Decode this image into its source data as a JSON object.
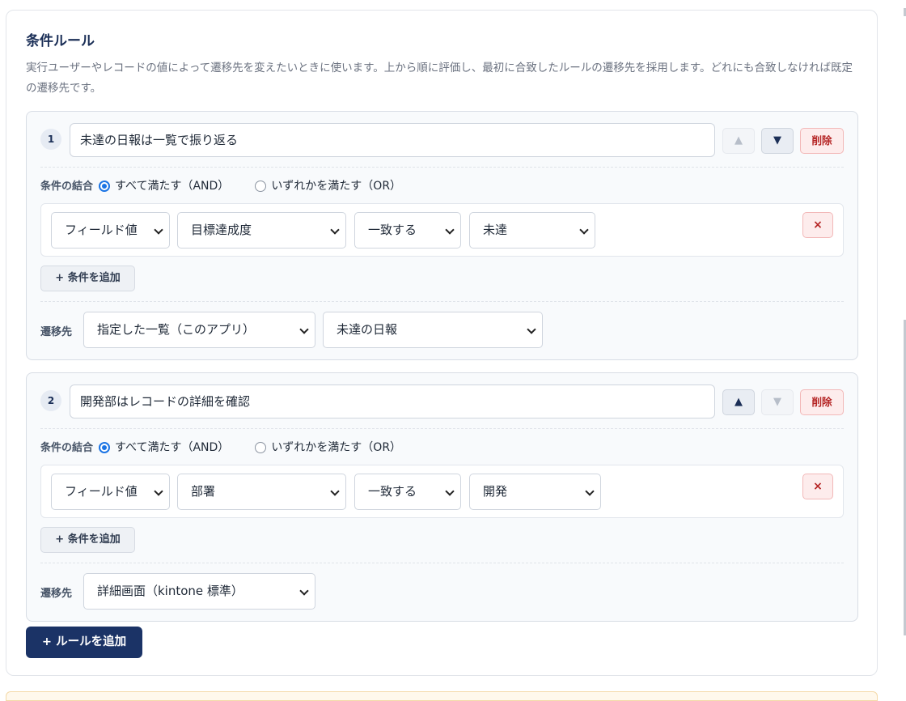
{
  "section": {
    "title": "条件ルール",
    "description": "実行ユーザーやレコードの値によって遷移先を変えたいときに使います。上から順に評価し、最初に合致したルールの遷移先を採用します。どれにも合致しなければ既定の遷移先です。"
  },
  "labels": {
    "combine": "条件の結合",
    "and": "すべて満たす（AND）",
    "or": "いずれかを満たす（OR）",
    "add_condition": "+ 条件を追加",
    "destination": "遷移先",
    "delete": "削除",
    "remove": "×",
    "up": "▲",
    "down": "▼",
    "add_rule": "+ ルールを追加"
  },
  "rules": [
    {
      "number": "1",
      "name": "未達の日報は一覧で振り返る",
      "combine": "and",
      "up_enabled": false,
      "down_enabled": true,
      "condition": {
        "type": "フィールド値",
        "field": "目標達成度",
        "operator": "一致する",
        "value": "未達"
      },
      "destination": {
        "type": "指定した一覧（このアプリ）",
        "view": "未達の日報"
      }
    },
    {
      "number": "2",
      "name": "開発部はレコードの詳細を確認",
      "combine": "and",
      "up_enabled": true,
      "down_enabled": false,
      "condition": {
        "type": "フィールド値",
        "field": "部署",
        "operator": "一致する",
        "value": "開発"
      },
      "destination": {
        "type": "詳細画面（kintone 標準）"
      }
    }
  ]
}
